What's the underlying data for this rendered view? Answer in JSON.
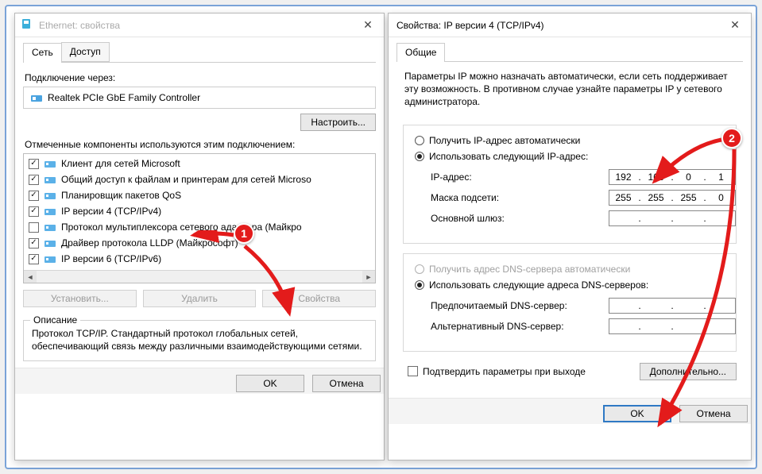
{
  "left": {
    "title": "Ethernet: свойства",
    "tabs": {
      "network": "Сеть",
      "access": "Доступ"
    },
    "connect_via": "Подключение через:",
    "adapter": "Realtek PCIe GbE Family Controller",
    "configure": "Настроить...",
    "components_label": "Отмеченные компоненты используются этим подключением:",
    "items": [
      {
        "checked": true,
        "label": "Клиент для сетей Microsoft"
      },
      {
        "checked": true,
        "label": "Общий доступ к файлам и принтерам для сетей Microso"
      },
      {
        "checked": true,
        "label": "Планировщик пакетов QoS"
      },
      {
        "checked": true,
        "label": "IP версии 4 (TCP/IPv4)"
      },
      {
        "checked": false,
        "label": "Протокол мультиплексора сетевого адаптера (Майкро"
      },
      {
        "checked": true,
        "label": "Драйвер протокола LLDP (Майкрософт)"
      },
      {
        "checked": true,
        "label": "IP версии 6 (TCP/IPv6)"
      }
    ],
    "install": "Установить...",
    "uninstall": "Удалить",
    "properties": "Свойства",
    "desc_legend": "Описание",
    "desc_text": "Протокол TCP/IP. Стандартный протокол глобальных сетей, обеспечивающий связь между различными взаимодействующими сетями.",
    "ok": "OK",
    "cancel": "Отмена"
  },
  "right": {
    "title": "Свойства: IP версии 4 (TCP/IPv4)",
    "tab_general": "Общие",
    "intro": "Параметры IP можно назначать автоматически, если сеть поддерживает эту возможность. В противном случае узнайте параметры IP у сетевого администратора.",
    "radio_auto_ip": "Получить IP-адрес автоматически",
    "radio_static_ip": "Использовать следующий IP-адрес:",
    "ip_label": "IP-адрес:",
    "ip": [
      "192",
      "168",
      "0",
      "1"
    ],
    "mask_label": "Маска подсети:",
    "mask": [
      "255",
      "255",
      "255",
      "0"
    ],
    "gw_label": "Основной шлюз:",
    "gw": [
      "",
      "",
      "",
      ""
    ],
    "radio_auto_dns": "Получить адрес DNS-сервера автоматически",
    "radio_static_dns": "Использовать следующие адреса DNS-серверов:",
    "dns1_label": "Предпочитаемый DNS-сервер:",
    "dns1": [
      "",
      "",
      "",
      ""
    ],
    "dns2_label": "Альтернативный DNS-сервер:",
    "dns2": [
      "",
      "",
      "",
      ""
    ],
    "confirm_on_exit": "Подтвердить параметры при выходе",
    "advanced": "Дополнительно...",
    "ok": "OK",
    "cancel": "Отмена"
  },
  "anno": {
    "one": "1",
    "two": "2"
  }
}
